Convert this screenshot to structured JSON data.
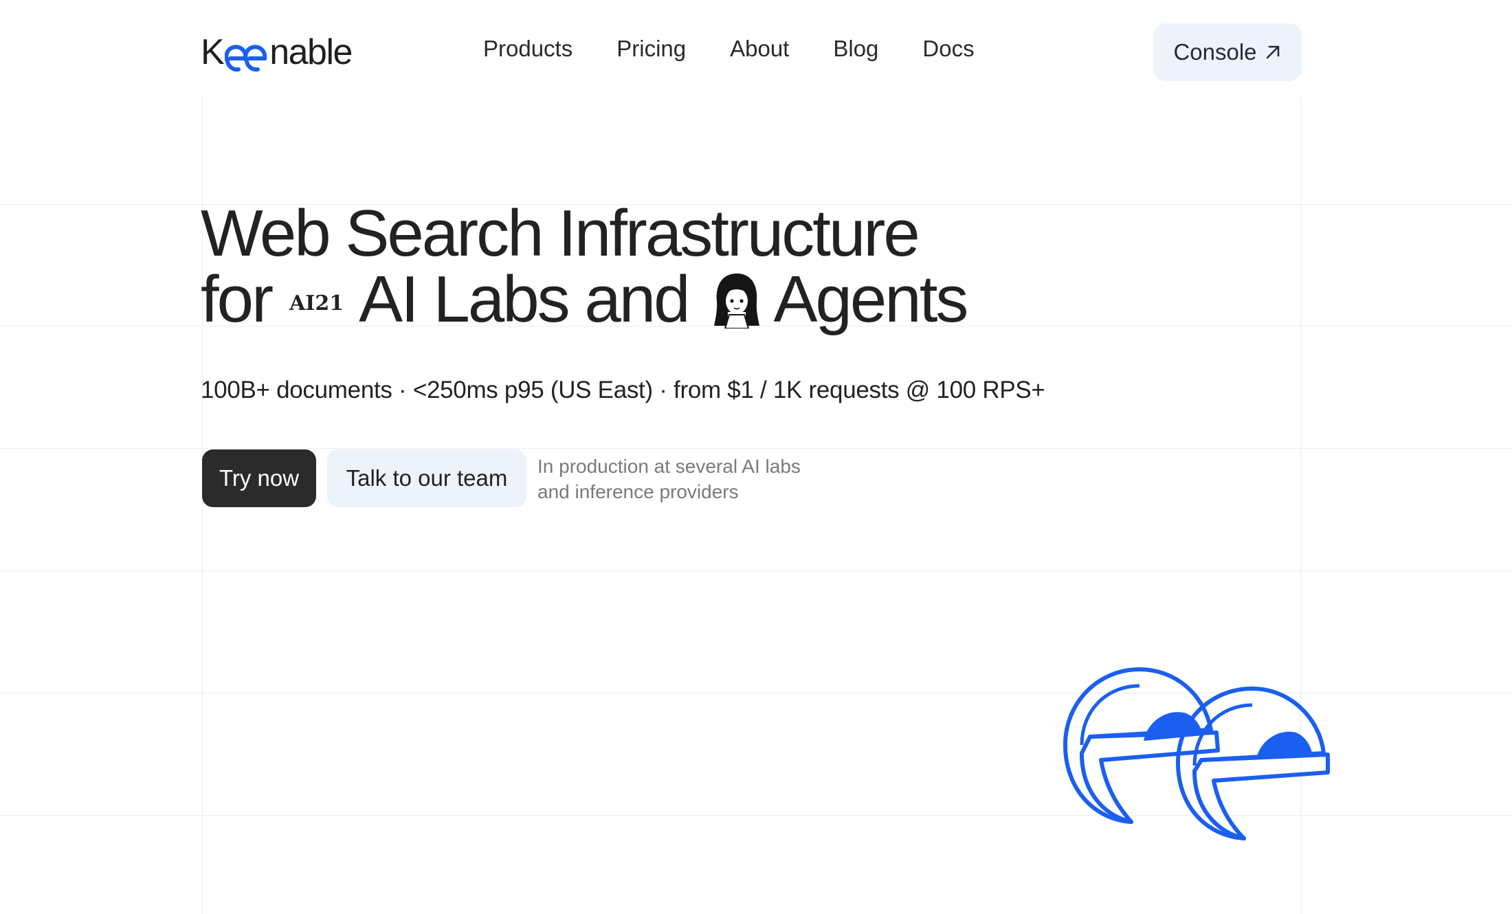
{
  "header": {
    "logo_k": "K",
    "logo_rest": "nable",
    "nav": [
      "Products",
      "Pricing",
      "About",
      "Blog",
      "Docs"
    ],
    "console_label": "Console"
  },
  "hero": {
    "title_line1": "Web Search Infrastructure",
    "title_for": "for",
    "ai21_logo": "AI21",
    "title_mid": "AI Labs and",
    "title_end": "Agents",
    "subtitle": "100B+ documents · <250ms p95 (US East) · from $1 / 1K requests @ 100 RPS+",
    "try_label": "Try now",
    "talk_label": "Talk to our team",
    "note_line1": "In production at several AI labs",
    "note_line2": "and inference providers"
  },
  "colors": {
    "brand_blue": "#1a5ff0",
    "dark": "#2b2b2b",
    "light_button": "#eef3fb"
  },
  "icons": [
    "arrow-up-right-icon",
    "keenable-ee-logo-icon",
    "ai21-logo",
    "anime-girl-avatar-icon"
  ]
}
